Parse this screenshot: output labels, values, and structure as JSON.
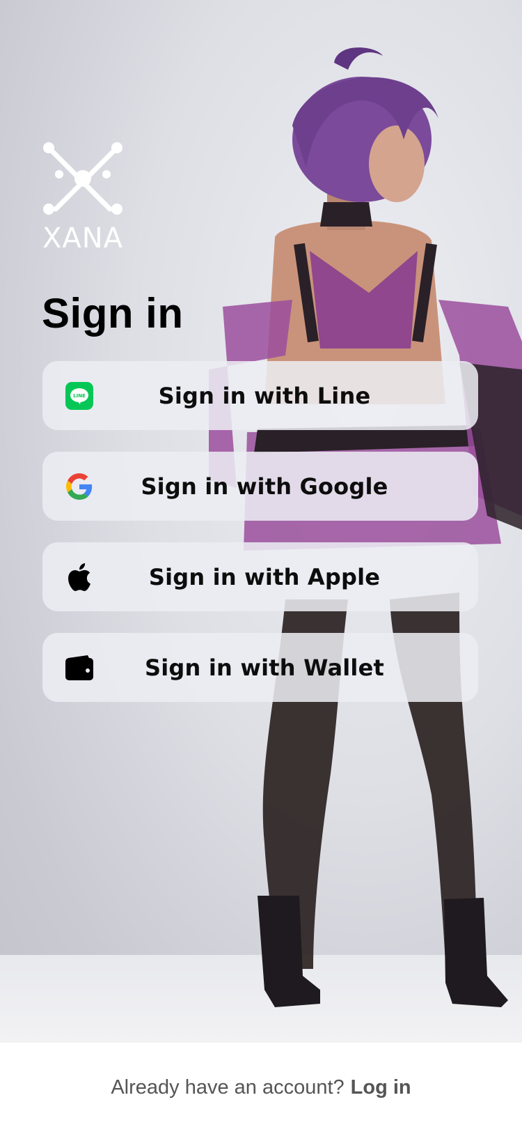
{
  "brand": {
    "name": "XANA"
  },
  "title": "Sign in",
  "buttons": {
    "line": {
      "label": "Sign in with Line",
      "icon": "line-icon",
      "icon_text": "LINE",
      "icon_color": "#06C755"
    },
    "google": {
      "label": "Sign in with Google",
      "icon": "google-icon"
    },
    "apple": {
      "label": "Sign in with Apple",
      "icon": "apple-icon"
    },
    "wallet": {
      "label": "Sign in with Wallet",
      "icon": "wallet-icon"
    }
  },
  "footer": {
    "prompt": "Already have an account?",
    "link": "Log in"
  }
}
